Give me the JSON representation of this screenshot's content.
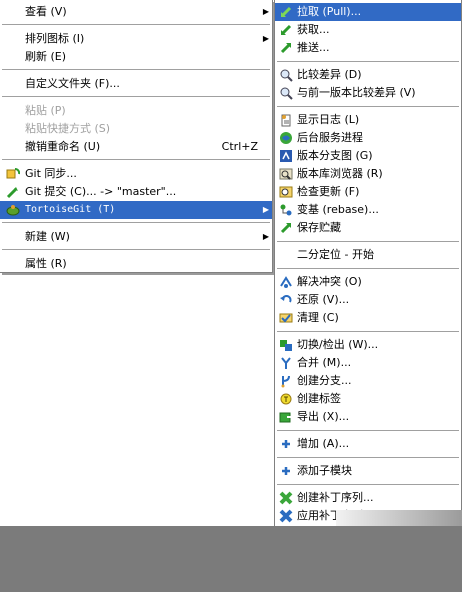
{
  "main_menu": {
    "items": [
      {
        "label": "查看 (V)"
      },
      {
        "label": "排列图标 (I)"
      },
      {
        "label": "刷新 (E)"
      },
      {
        "label": "自定义文件夹 (F)..."
      },
      {
        "label": "粘贴 (P)"
      },
      {
        "label": "粘贴快捷方式 (S)"
      },
      {
        "label": "撤销重命名 (U)",
        "shortcut": "Ctrl+Z"
      },
      {
        "label": "Git 同步..."
      },
      {
        "label": "Git 提交 (C)... -> \"master\"..."
      },
      {
        "label": "TortoiseGit (T)"
      },
      {
        "label": "新建 (W)"
      },
      {
        "label": "属性 (R)"
      }
    ]
  },
  "sub_menu": {
    "items": [
      {
        "label": "拉取 (Pull)...",
        "icon": "pull-icon"
      },
      {
        "label": "获取...",
        "icon": "fetch-icon"
      },
      {
        "label": "推送...",
        "icon": "push-icon"
      },
      {
        "label": "比较差异 (D)",
        "icon": "diff-icon"
      },
      {
        "label": "与前一版本比较差异 (V)",
        "icon": "diff-previous-icon"
      },
      {
        "label": "显示日志 (L)",
        "icon": "log-icon"
      },
      {
        "label": "后台服务进程",
        "icon": "daemon-icon"
      },
      {
        "label": "版本分支图 (G)",
        "icon": "revision-graph-icon"
      },
      {
        "label": "版本库浏览器 (R)",
        "icon": "repo-browser-icon"
      },
      {
        "label": "检查更新 (F)",
        "icon": "check-modifications-icon"
      },
      {
        "label": "变基 (rebase)...",
        "icon": "rebase-icon"
      },
      {
        "label": "保存贮藏",
        "icon": "stash-save-icon"
      },
      {
        "label": "二分定位 - 开始",
        "icon": ""
      },
      {
        "label": "解决冲突 (O)",
        "icon": "resolve-icon"
      },
      {
        "label": "还原 (V)...",
        "icon": "revert-icon"
      },
      {
        "label": "清理 (C)",
        "icon": "cleanup-icon"
      },
      {
        "label": "切换/检出 (W)...",
        "icon": "switch-icon"
      },
      {
        "label": "合并 (M)...",
        "icon": "merge-icon"
      },
      {
        "label": "创建分支...",
        "icon": "branch-icon"
      },
      {
        "label": "创建标签",
        "icon": "tag-icon"
      },
      {
        "label": "导出 (X)...",
        "icon": "export-icon"
      },
      {
        "label": "增加 (A)...",
        "icon": "add-icon"
      },
      {
        "label": "添加子模块",
        "icon": "submodule-add-icon"
      },
      {
        "label": "创建补丁序列...",
        "icon": "create-patch-icon"
      },
      {
        "label": "应用补丁序列...",
        "icon": "apply-patch-icon"
      }
    ]
  },
  "colors": {
    "highlight": "#316ac5",
    "disabled_text": "#a0a0a0"
  }
}
